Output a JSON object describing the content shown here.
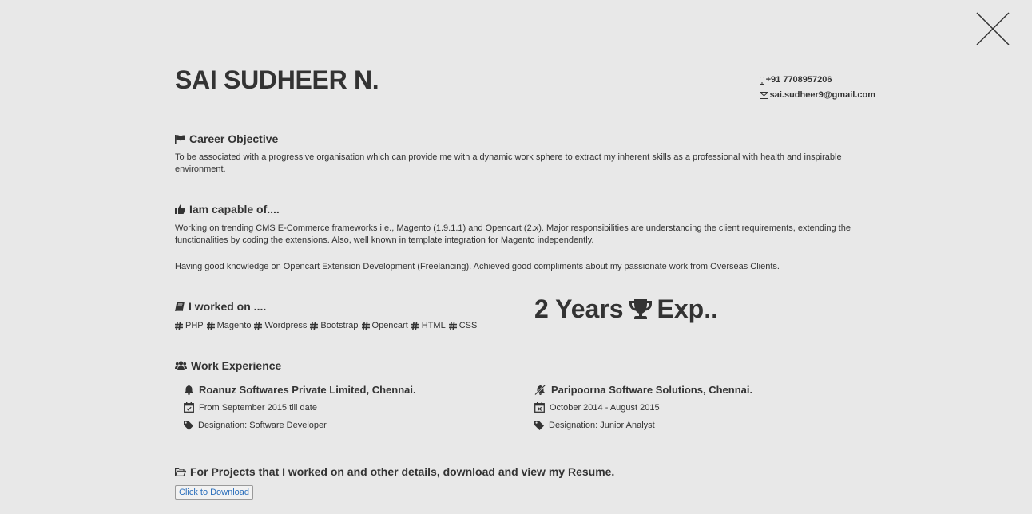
{
  "profile": {
    "name": "SAI SUDHEER N.",
    "phone": "+91 7708957206",
    "email": "sai.sudheer9@gmail.com"
  },
  "sections": {
    "objective": {
      "title": "Career Objective",
      "text": "To be associated with a progressive organisation which can provide me with a dynamic work sphere to extract my inherent skills as a professional with health and inspirable environment."
    },
    "capable": {
      "title": "Iam capable of....",
      "text1": "Working on trending CMS E-Commerce frameworks i.e., Magento (1.9.1.1) and Opencart (2.x). Major responsibilities are understanding the client requirements, extending the functionalities by coding the extensions. Also, well known in template integration for Magento independently.",
      "text2": "Having good knowledge on Opencart Extension Development (Freelancing). Achieved good compliments about my passionate work from Overseas Clients."
    },
    "worked_on": {
      "title": "I worked on ....",
      "skills": [
        "PHP",
        "Magento",
        "Wordpress",
        "Bootstrap",
        "Opencart",
        "HTML",
        "CSS"
      ]
    },
    "experience_badge": {
      "left": "2 Years",
      "right": "Exp.."
    },
    "work": {
      "title": "Work Experience",
      "jobs": [
        {
          "company": "Roanuz Softwares Private Limited, Chennai.",
          "period": "From September 2015 till date",
          "designation": "Designation: Software Developer"
        },
        {
          "company": "Paripoorna Software Solutions, Chennai.",
          "period": "October 2014 - August 2015",
          "designation": "Designation: Junior Analyst"
        }
      ]
    },
    "resume": {
      "title": "For Projects that I worked on and other details, download and view my Resume.",
      "button": "Click to Download"
    }
  },
  "icons": {
    "close": "close-icon",
    "phone": "mobile-phone-icon",
    "email": "envelope-icon",
    "objective": "flag-icon",
    "capable": "thumbs-up-icon",
    "worked_on": "book-icon",
    "tag": "hashtag-icon",
    "trophy": "trophy-icon",
    "work": "users-icon",
    "current_job": "bell-icon",
    "past_job": "bell-slash-icon",
    "calendar_check": "calendar-check-icon",
    "calendar_x": "calendar-times-icon",
    "designation": "tag-icon",
    "resume": "folder-open-icon"
  }
}
